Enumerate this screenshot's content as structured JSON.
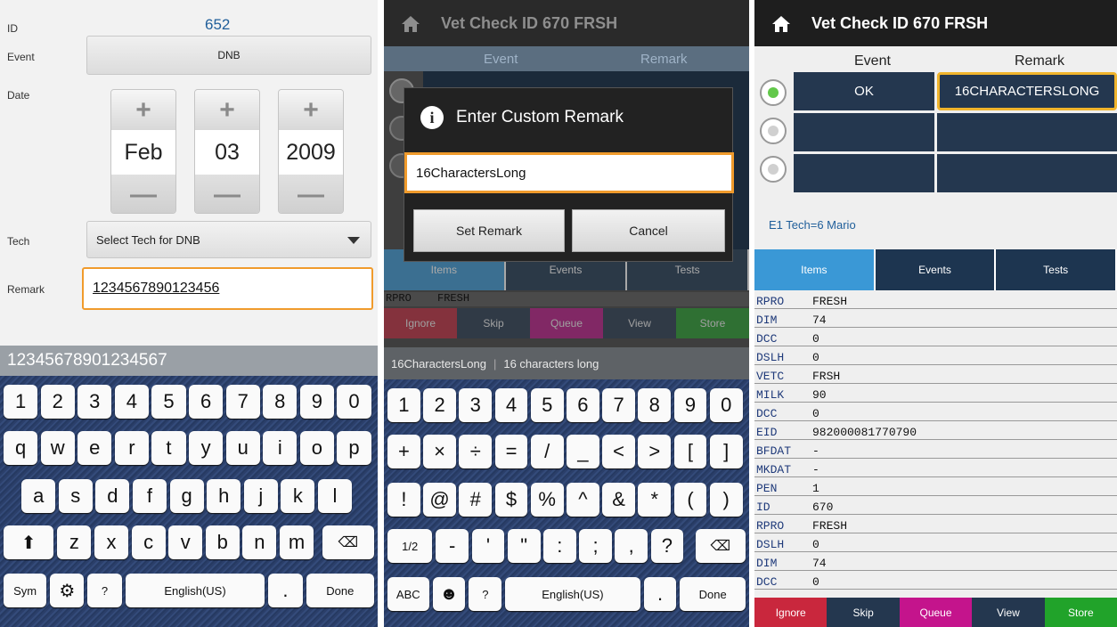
{
  "screen1": {
    "labels": {
      "id": "ID",
      "event": "Event",
      "date": "Date",
      "tech": "Tech",
      "remark": "Remark"
    },
    "id_value": "652",
    "event_value": "DNB",
    "date": {
      "month": "Feb",
      "day": "03",
      "year": "2009",
      "plus": "+",
      "minus": "—"
    },
    "tech_select": "Select Tech for DNB",
    "remark_value": "1234567890123456",
    "suggestion": "12345678901234567",
    "keyboard": {
      "row1": [
        "1",
        "2",
        "3",
        "4",
        "5",
        "6",
        "7",
        "8",
        "9",
        "0"
      ],
      "row2": [
        "q",
        "w",
        "e",
        "r",
        "t",
        "y",
        "u",
        "i",
        "o",
        "p"
      ],
      "row3": [
        "a",
        "s",
        "d",
        "f",
        "g",
        "h",
        "j",
        "k",
        "l"
      ],
      "row4": [
        "z",
        "x",
        "c",
        "v",
        "b",
        "n",
        "m"
      ],
      "sym": "Sym",
      "help": "?",
      "space": "English(US)",
      "period": ".",
      "done": "Done"
    }
  },
  "screen2": {
    "header": "Vet Check ID 670 FRSH",
    "col_event": "Event",
    "col_remark": "Remark",
    "dialog_title": "Enter Custom Remark",
    "dialog_value": "16CharactersLong",
    "set_remark": "Set Remark",
    "cancel": "Cancel",
    "tabs": [
      "Items",
      "Events",
      "Tests"
    ],
    "row_key": "RPRO",
    "row_val": "FRESH",
    "buttons": [
      "Ignore",
      "Skip",
      "Queue",
      "View",
      "Store"
    ],
    "suggest_a": "16CharactersLong",
    "suggest_b": "16 characters long",
    "keyboard": {
      "row1": [
        "1",
        "2",
        "3",
        "4",
        "5",
        "6",
        "7",
        "8",
        "9",
        "0"
      ],
      "row2": [
        "+",
        "×",
        "÷",
        "=",
        "/",
        "_",
        "<",
        ">",
        "[",
        "]"
      ],
      "row3": [
        "!",
        "@",
        "#",
        "$",
        "%",
        "^",
        "&",
        "*",
        "(",
        ")"
      ],
      "row4": [
        "1/2",
        "-",
        "'",
        "\"",
        ":",
        ";",
        ",",
        "?"
      ],
      "abc": "ABC",
      "help": "?",
      "space": "English(US)",
      "period": ".",
      "done": "Done"
    }
  },
  "screen3": {
    "header": "Vet Check ID 670 FRSH",
    "col_event": "Event",
    "col_remark": "Remark",
    "row1_event": "OK",
    "row1_remark": "16CHARACTERSLONG",
    "tech_line": "E1 Tech=6 Mario",
    "tabs": [
      "Items",
      "Events",
      "Tests"
    ],
    "rows": [
      {
        "k": "RPRO",
        "v": "FRESH"
      },
      {
        "k": "DIM",
        "v": "74"
      },
      {
        "k": "DCC",
        "v": "0"
      },
      {
        "k": "DSLH",
        "v": "0"
      },
      {
        "k": "VETC",
        "v": "FRSH"
      },
      {
        "k": "MILK",
        "v": "90"
      },
      {
        "k": "DCC",
        "v": "0"
      },
      {
        "k": "EID",
        "v": "982000081770790"
      },
      {
        "k": "BFDAT",
        "v": "-"
      },
      {
        "k": "MKDAT",
        "v": "-"
      },
      {
        "k": "PEN",
        "v": "1"
      },
      {
        "k": "ID",
        "v": "670"
      },
      {
        "k": "RPRO",
        "v": "FRESH"
      },
      {
        "k": "DSLH",
        "v": "0"
      },
      {
        "k": "DIM",
        "v": "74"
      },
      {
        "k": "DCC",
        "v": "0"
      }
    ],
    "buttons": [
      "Ignore",
      "Skip",
      "Queue",
      "View",
      "Store"
    ]
  },
  "colors": {
    "accent": "#f09b2c",
    "navy": "#24374f",
    "tab_active": "#3a98d6",
    "ignore": "#c9273d",
    "queue": "#c4148c",
    "store": "#21a32a"
  }
}
